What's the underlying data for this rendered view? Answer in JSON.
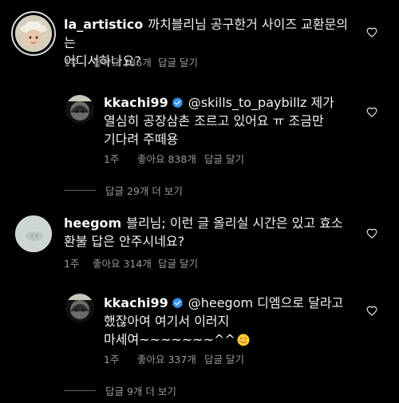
{
  "comments": [
    {
      "username": "la_artistico",
      "text_line1": "까치블리님 공구한거 사이즈 교환문의는",
      "text_line2": "어디서하나요?",
      "time": "1주",
      "likes": "좋아요 386개",
      "reply": "답글 달기"
    },
    {
      "username": "kkachi99",
      "mention": "@skills_to_paybillz",
      "text_line1_rest": " 제가",
      "text_line2": "열심히 공장삼촌 조르고 있어요 ㅠ 조금만",
      "text_line3": "기다려 주떼용",
      "time": "1주",
      "likes": "좋아요 838개",
      "reply": "답글 달기"
    },
    {
      "view_replies": "답글 29개 더 보기"
    },
    {
      "username": "heegom",
      "text_line1": "블리님; 이런 글 올리실 시간은 있고 효소",
      "text_line2": "환불 답은 안주시네요?",
      "time": "1주",
      "likes": "좋아요 314개",
      "reply": "답글 달기"
    },
    {
      "username": "kkachi99",
      "mention": "@heegom",
      "text_line1_rest": " 디엠으로 달라고",
      "text_line2": "했잖아여 여기서 이러지",
      "text_line3": "마세여~~~~~~~^^",
      "time": "1주",
      "likes": "좋아요 337개",
      "reply": "답글 달기"
    },
    {
      "view_replies": "답글 9개 더 보기"
    }
  ],
  "colors": {
    "background": "#000000",
    "text": "#f2f2f2",
    "meta": "#9a9a9a",
    "verified": "#3897f0"
  }
}
